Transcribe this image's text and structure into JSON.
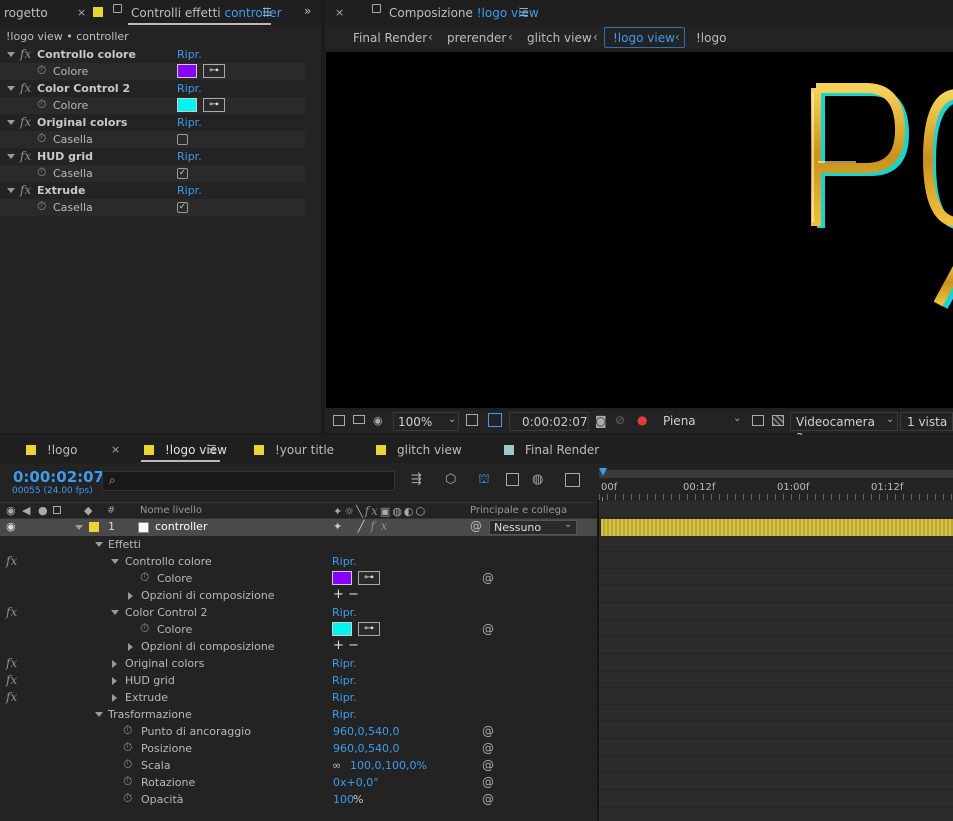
{
  "effects_panel": {
    "tab_project": "rogetto",
    "tab_controls_prefix": "Controlli effetti",
    "tab_controls_layer": "controller",
    "subtitle": "!logo view • controller",
    "reset": "Ripr.",
    "effects": [
      {
        "name": "Controllo colore",
        "prop": "Colore",
        "kind": "color",
        "color": "#8a00ff"
      },
      {
        "name": "Color Control 2",
        "prop": "Colore",
        "kind": "color",
        "color": "#00f5f0"
      },
      {
        "name": "Original colors",
        "prop": "Casella",
        "kind": "checkbox",
        "checked": false
      },
      {
        "name": "HUD grid",
        "prop": "Casella",
        "kind": "checkbox",
        "checked": true
      },
      {
        "name": "Extrude",
        "prop": "Casella",
        "kind": "checkbox",
        "checked": true
      }
    ]
  },
  "comp_panel": {
    "tab_prefix": "Composizione",
    "tab_comp": "!logo view",
    "breadcrumbs": [
      "Final Render",
      "prerender",
      "glitch view",
      "!logo view",
      "!logo"
    ],
    "logo_text": "PO",
    "footer": {
      "zoom": "100%",
      "time": "0:00:02:07",
      "resolution": "Piena",
      "camera": "Videocamera a...",
      "views": "1 vista"
    }
  },
  "timeline": {
    "tabs": [
      {
        "label": "!logo",
        "color": "#e8d437"
      },
      {
        "label": "!logo view",
        "color": "#e8d437"
      },
      {
        "label": "!your title",
        "color": "#e8d437"
      },
      {
        "label": "glitch view",
        "color": "#e8d437"
      },
      {
        "label": "Final Render",
        "color": "#9fc9c6"
      }
    ],
    "timecode": "0:00:02:07",
    "frames": "00055 (24.00 fps)",
    "col_hash": "#",
    "col_name": "Nome livello",
    "col_parent": "Principale e collega",
    "layer_number": "1",
    "layer_name": "controller",
    "parent_value": "Nessuno",
    "ruler": [
      "00f",
      "00:12f",
      "01:00f",
      "01:12f"
    ],
    "props": {
      "effetti": "Effetti",
      "ctrl_colore": "Controllo colore",
      "colore": "Colore",
      "opzioni": "Opzioni di composizione",
      "color_ctrl2": "Color Control 2",
      "orig": "Original colors",
      "hud": "HUD grid",
      "extrude": "Extrude",
      "trasf": "Trasformazione",
      "punto": "Punto di ancoraggio",
      "posizione": "Posizione",
      "scala": "Scala",
      "rotazione": "Rotazione",
      "opacita": "Opacità",
      "reset": "Ripr.",
      "punto_val": "960,0,540,0",
      "pos_val": "960,0,540,0",
      "scala_val": "100,0,100,0%",
      "rot_val": "0x+0,0°",
      "opac_val": "100",
      "opac_unit": "%"
    }
  }
}
